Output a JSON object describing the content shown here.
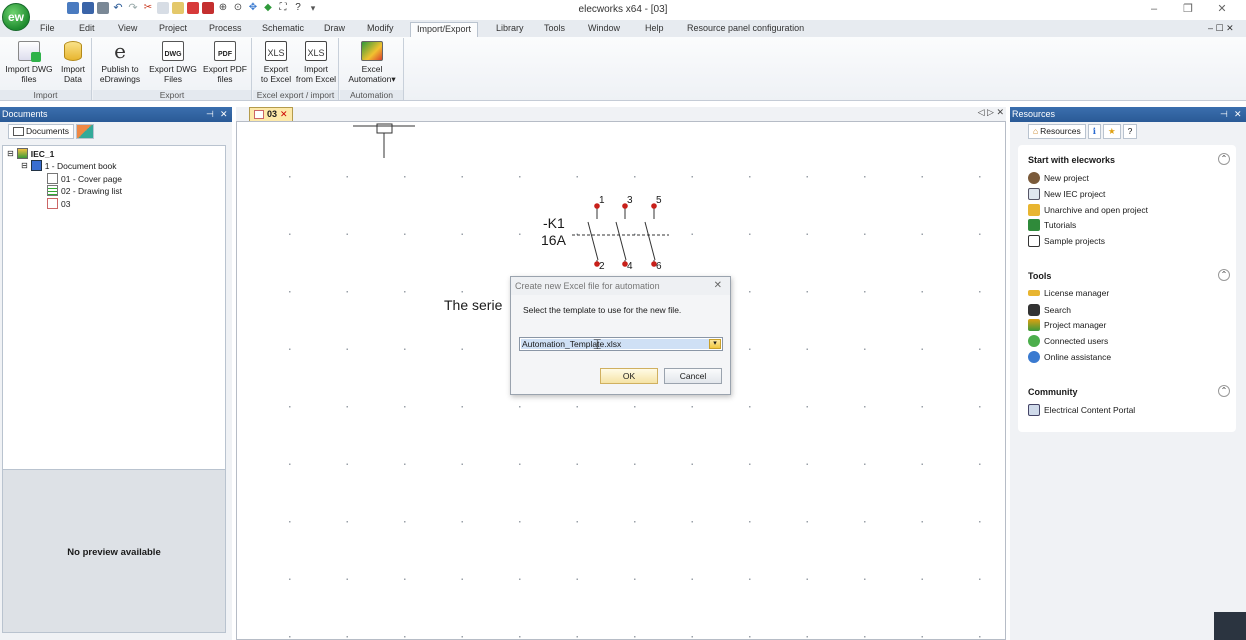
{
  "app": {
    "logo": "ew",
    "window_title": "elecworks x64 - [03]"
  },
  "window_buttons": {
    "minimize": "–",
    "restore": "❐",
    "close": "✕"
  },
  "mdi_buttons": "– ☐ ✕",
  "menu": [
    "File",
    "Edit",
    "View",
    "Project",
    "Process",
    "Schematic",
    "Draw",
    "Modify",
    "Import/Export",
    "Library",
    "Tools",
    "Window",
    "Help",
    "Resource panel configuration"
  ],
  "active_menu": "Import/Export",
  "ribbon": {
    "groups": [
      {
        "label": "Import",
        "buttons": [
          {
            "l1": "Import DWG",
            "l2": "files"
          },
          {
            "l1": "Import",
            "l2": "Data"
          }
        ]
      },
      {
        "label": "Export",
        "buttons": [
          {
            "l1": "Publish to",
            "l2": "eDrawings"
          },
          {
            "l1": "Export DWG",
            "l2": "Files"
          },
          {
            "l1": "Export PDF",
            "l2": "files"
          }
        ]
      },
      {
        "label": "Excel export / import",
        "buttons": [
          {
            "l1": "Export",
            "l2": "to Excel"
          },
          {
            "l1": "Import",
            "l2": "from Excel"
          }
        ]
      },
      {
        "label": "Automation",
        "buttons": [
          {
            "l1": "Excel",
            "l2": "Automation"
          }
        ]
      }
    ],
    "icon_texts": {
      "dwg": "DWG",
      "pdf": "PDF",
      "xls": "XLS",
      "publish": "e"
    }
  },
  "documents_panel": {
    "title": "Documents",
    "tab": "Documents",
    "tree": [
      {
        "label": "IEC_1",
        "bold": true
      },
      {
        "label": "1 - Document book"
      },
      {
        "label": "01 - Cover page"
      },
      {
        "label": "02 - Drawing list"
      },
      {
        "label": "03"
      }
    ],
    "preview_text": "No preview available"
  },
  "document_tab": {
    "label": "03"
  },
  "schematic": {
    "tag": "-K1",
    "rating": "16A",
    "top_terminals": [
      "1",
      "3",
      "5"
    ],
    "bottom_terminals": [
      "2",
      "4",
      "6"
    ],
    "text": "The serie"
  },
  "resources_panel": {
    "title": "Resources",
    "tab": "Resources",
    "sections": [
      {
        "title": "Start with elecworks",
        "items": [
          "New project",
          "New IEC project",
          "Unarchive and open project",
          "Tutorials",
          "Sample projects"
        ]
      },
      {
        "title": "Tools",
        "items": [
          "License manager",
          "Search",
          "Project manager",
          "Connected users",
          "Online assistance"
        ]
      },
      {
        "title": "Community",
        "items": [
          "Electrical Content Portal"
        ]
      }
    ]
  },
  "dialog": {
    "title": "Create new Excel file for automation",
    "prompt": "Select the template to use for the new file.",
    "selected_template": "Automation_Template.xlsx",
    "ok": "OK",
    "cancel": "Cancel",
    "close": "✕"
  },
  "colors": {
    "accent": "#2a5a96",
    "active_tab": "#fbfcfd",
    "selection": "#cfe0f5"
  }
}
